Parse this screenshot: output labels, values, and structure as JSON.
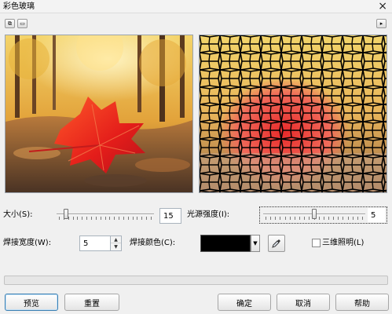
{
  "window": {
    "title": "彩色玻璃",
    "close_glyph": "×"
  },
  "toolbar": {
    "left_buttons": [
      {
        "name": "dual-preview",
        "glyph": "⧉"
      },
      {
        "name": "single-preview",
        "glyph": "▭"
      }
    ],
    "right_button_glyph": "▸"
  },
  "previews": {
    "original_icon": "autumn-leaf-photo",
    "result_icon": "stained-glass-effect-photo"
  },
  "controls": {
    "size_label": "大小(S):",
    "size_value": "15",
    "size_level": 0.08,
    "light_label": "光源强度(I):",
    "light_value": "5",
    "light_level": 0.5,
    "weld_width_label": "焊接宽度(W):",
    "weld_width_value": "5",
    "weld_color_label": "焊接颜色(C):",
    "weld_color": "#000000",
    "eyedropper_icon": "eyedropper-icon",
    "lighting_3d_label": "三维照明(L)",
    "lighting_3d_checked": false
  },
  "progress": {
    "fill": 0
  },
  "buttons": {
    "preview": "预览",
    "reset": "重置",
    "ok": "确定",
    "cancel": "取消",
    "help": "帮助"
  },
  "colors": {
    "accent_border": "#3c7fb1",
    "dialog_bg": "#f0f0f0"
  }
}
